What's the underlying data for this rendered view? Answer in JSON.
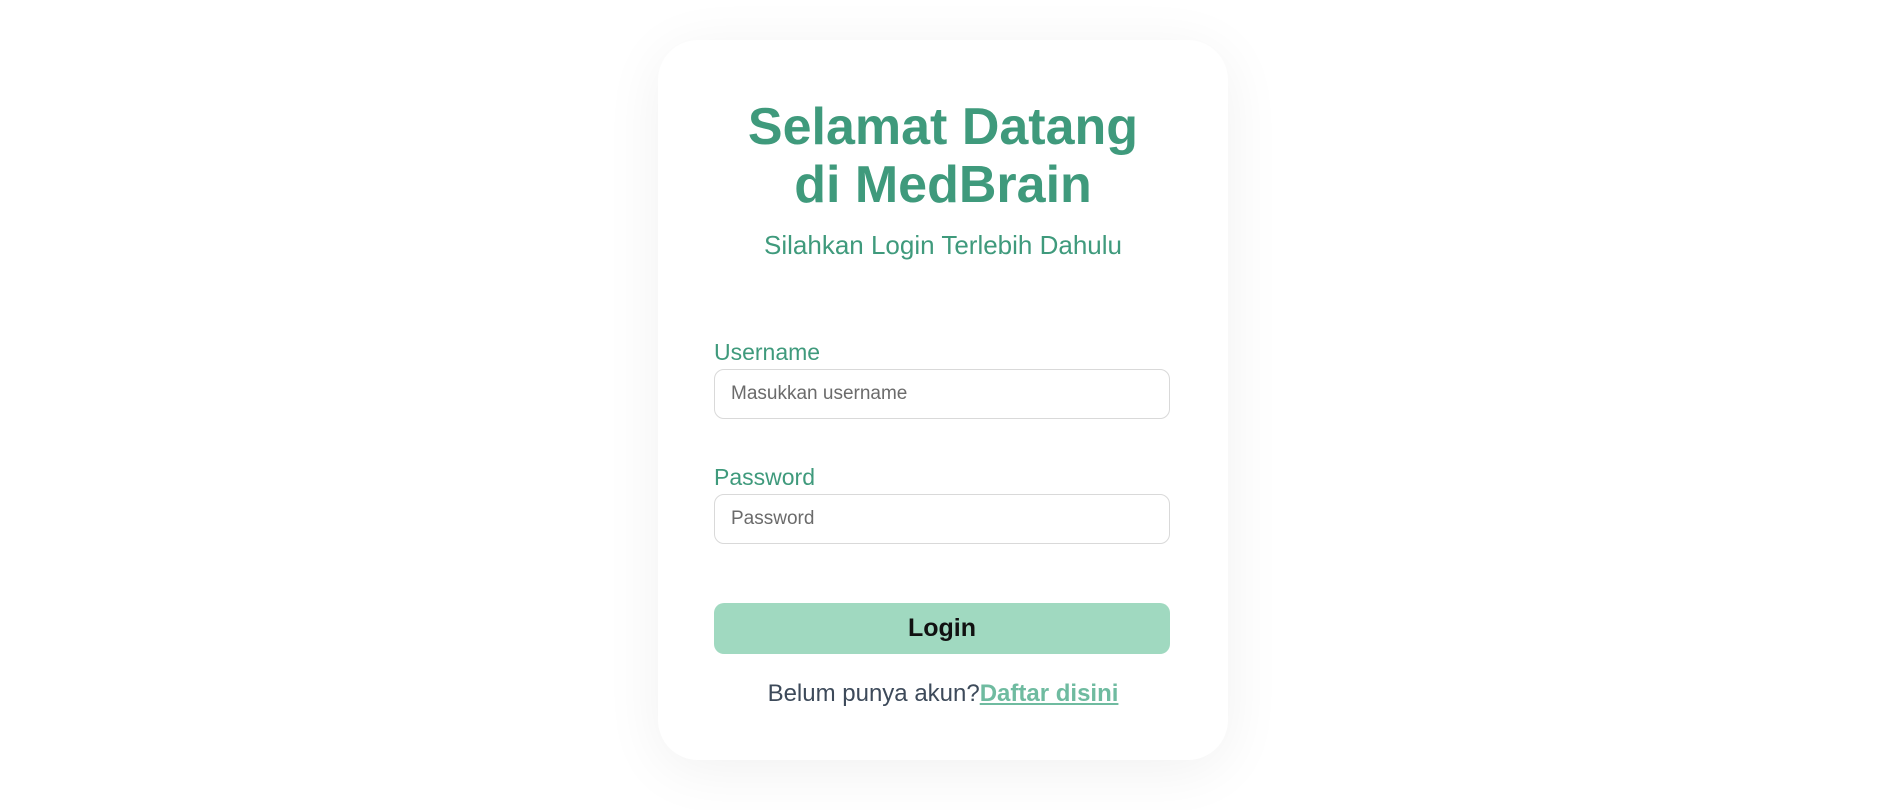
{
  "header": {
    "title_line1": "Selamat Datang",
    "title_line2": "di MedBrain",
    "subtitle": "Silahkan Login Terlebih Dahulu"
  },
  "form": {
    "username": {
      "label": "Username",
      "placeholder": "Masukkan username",
      "value": ""
    },
    "password": {
      "label": "Password",
      "placeholder": "Password",
      "value": ""
    },
    "submit_label": "Login"
  },
  "register": {
    "prompt": "Belum punya akun?",
    "link_text": "Daftar disini"
  },
  "colors": {
    "accent": "#3f9a7c",
    "button_bg": "#a0d9c0",
    "link": "#6fbba0"
  }
}
